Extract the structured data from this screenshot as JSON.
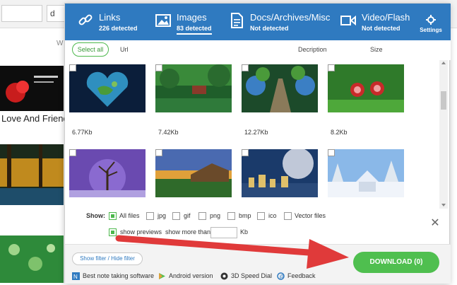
{
  "background": {
    "search_text": "d",
    "w_letter": "W",
    "caption": "Love And Friend"
  },
  "tabs": [
    {
      "label": "Links",
      "count": "226 detected",
      "icon": "link-icon"
    },
    {
      "label": "Images",
      "count": "83 detected",
      "icon": "image-icon",
      "active": true
    },
    {
      "label": "Docs/Archives/Misc",
      "count": "Not detected",
      "icon": "document-icon"
    },
    {
      "label": "Video/Flash",
      "count": "Not detected",
      "icon": "video-icon"
    }
  ],
  "settings_label": "Settings",
  "toolbar": {
    "select_all": "Select all",
    "col_url": "Url",
    "col_description": "Decription",
    "col_size": "Size"
  },
  "images": [
    {
      "size": "6.77Kb",
      "scene": "heart-earth"
    },
    {
      "size": "7.42Kb",
      "scene": "forest-house"
    },
    {
      "size": "12.27Kb",
      "scene": "garden-path"
    },
    {
      "size": "8.2Kb",
      "scene": "snails"
    },
    {
      "size": "",
      "scene": "tree-globe"
    },
    {
      "size": "",
      "scene": "sunset-house"
    },
    {
      "size": "",
      "scene": "planet-town"
    },
    {
      "size": "",
      "scene": "winter-house"
    }
  ],
  "filters": {
    "show_label": "Show:",
    "types": [
      {
        "label": "All files",
        "checked": true
      },
      {
        "label": "jpg",
        "checked": false
      },
      {
        "label": "gif",
        "checked": false
      },
      {
        "label": "png",
        "checked": false
      },
      {
        "label": "bmp",
        "checked": false
      },
      {
        "label": "ico",
        "checked": false
      },
      {
        "label": "Vector files",
        "checked": false
      }
    ],
    "show_previews": "show previews",
    "show_previews_checked": true,
    "show_more_than": "show more than",
    "kb_value": "",
    "kb_unit": "Kb"
  },
  "footer": {
    "show_filter": "Show filter / Hide filter",
    "download": "DOWNLOAD (0)",
    "links": [
      {
        "label": "Best note taking software",
        "icon": "note-icon"
      },
      {
        "label": "Android version",
        "icon": "android-icon"
      },
      {
        "label": "3D Speed Dial",
        "icon": "speed-dial-icon"
      },
      {
        "label": "Feedback",
        "icon": "feedback-icon"
      }
    ]
  },
  "colors": {
    "header": "#2f7ac0",
    "accent_green": "#4fbf4f",
    "arrow_red": "#e03a3a"
  }
}
